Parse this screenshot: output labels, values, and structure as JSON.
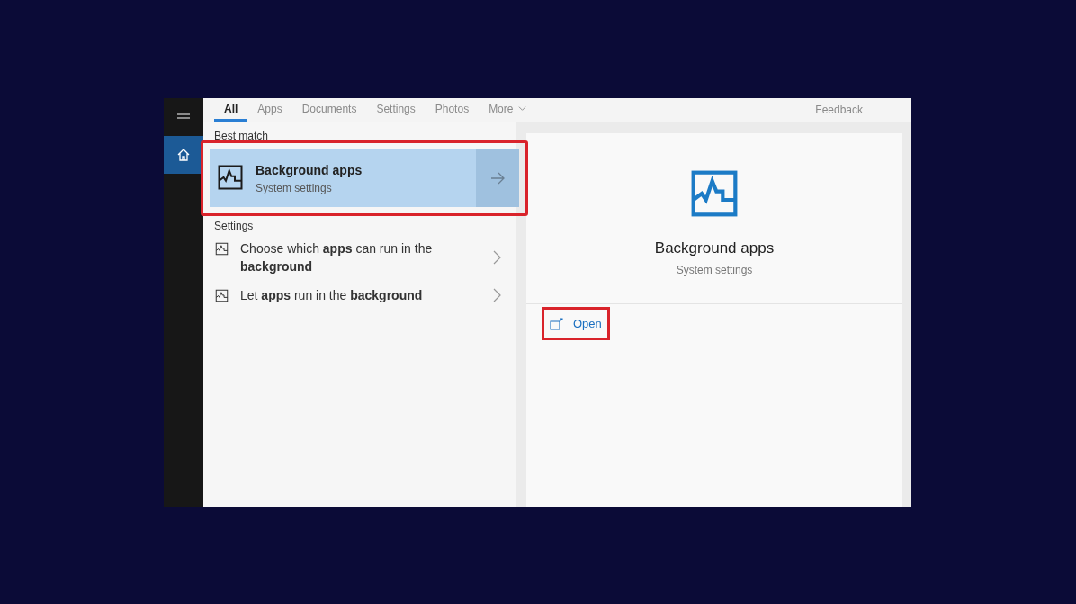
{
  "sidebar": {
    "items": [
      {
        "kind": "menu",
        "selected": false
      },
      {
        "kind": "home",
        "selected": true
      }
    ]
  },
  "tabs": [
    {
      "label": "All",
      "kind": "tab",
      "selected": true
    },
    {
      "label": "Apps",
      "kind": "tab",
      "selected": false
    },
    {
      "label": "Documents",
      "kind": "tab",
      "selected": false
    },
    {
      "label": "Settings",
      "kind": "tab",
      "selected": false
    },
    {
      "label": "Photos",
      "kind": "tab",
      "selected": false
    },
    {
      "label": "More",
      "kind": "menu",
      "selected": false
    }
  ],
  "feedback": "Feedback",
  "best_match": {
    "heading": "Best match",
    "title": "Background apps",
    "subtitle": "System settings",
    "highlighted": true
  },
  "settings": {
    "heading": "Settings",
    "items": [
      {
        "text": "Choose which **apps** can run in the **background**"
      },
      {
        "text": "Let **apps** run in the **background**"
      }
    ]
  },
  "preview": {
    "title": "Background apps",
    "subtitle": "System settings",
    "actions": [
      {
        "label": "Open",
        "highlighted": true
      }
    ]
  }
}
